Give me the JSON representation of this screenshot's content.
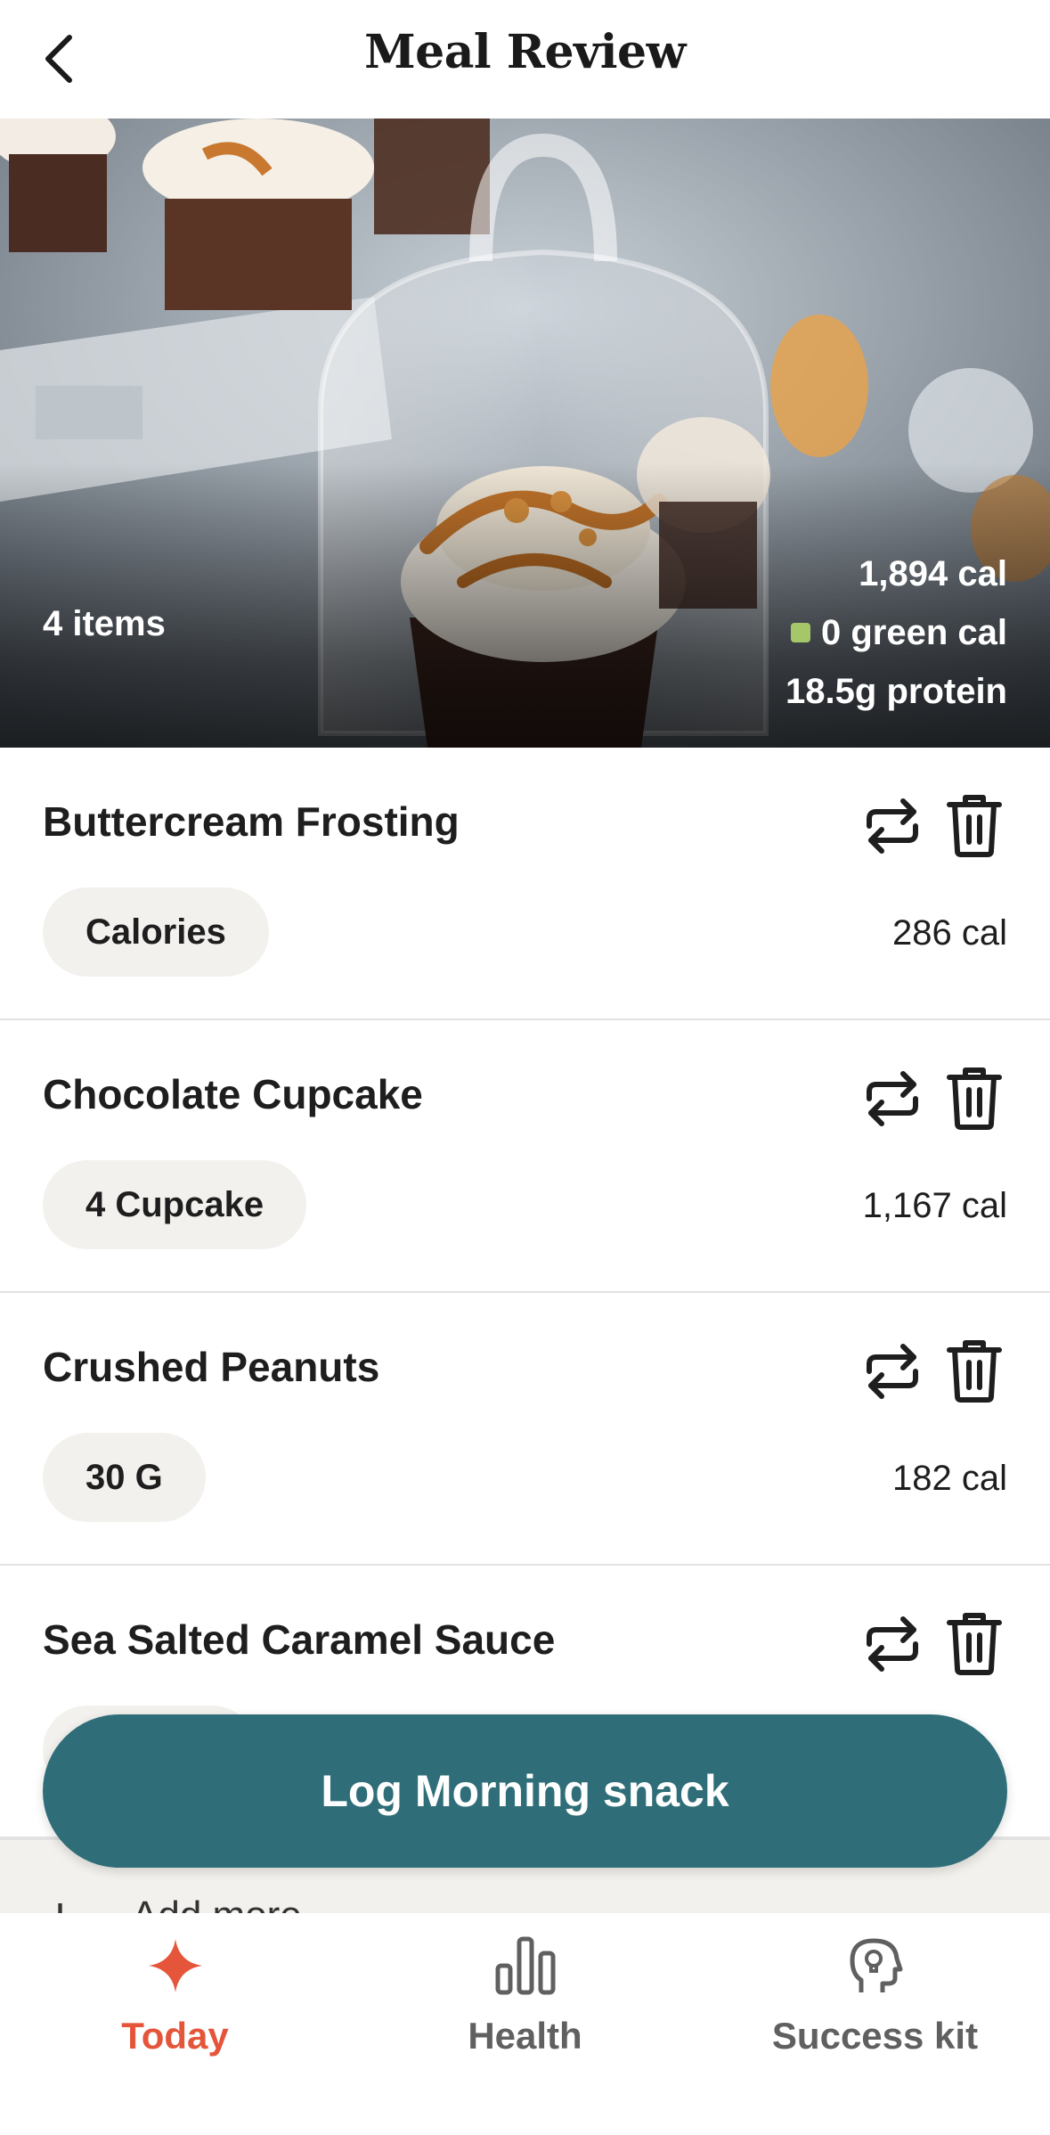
{
  "header": {
    "title": "Meal Review",
    "back_icon": "chevron-left-icon"
  },
  "hero": {
    "item_count": "4 items",
    "total_calories": "1,894 cal",
    "green_calories": "0 green cal",
    "protein": "18.5g protein",
    "green_color": "#a6c66a"
  },
  "items": [
    {
      "name": "Buttercream Frosting",
      "serving": "Calories",
      "calories": "286 cal"
    },
    {
      "name": "Chocolate Cupcake",
      "serving": "4 Cupcake",
      "calories": "1,167 cal"
    },
    {
      "name": "Crushed Peanuts",
      "serving": "30 G",
      "calories": "182 cal"
    },
    {
      "name": "Sea Salted Caramel Sauce",
      "serving": "",
      "calories": ""
    }
  ],
  "add_more": {
    "label": "Add more"
  },
  "log_button": {
    "label": "Log Morning snack",
    "color": "#2f6e78"
  },
  "tabbar": {
    "tabs": [
      {
        "label": "Today",
        "icon": "sparkle-icon",
        "active": true
      },
      {
        "label": "Health",
        "icon": "bar-chart-icon",
        "active": false
      },
      {
        "label": "Success kit",
        "icon": "head-idea-icon",
        "active": false
      }
    ],
    "active_color": "#e4553a"
  }
}
